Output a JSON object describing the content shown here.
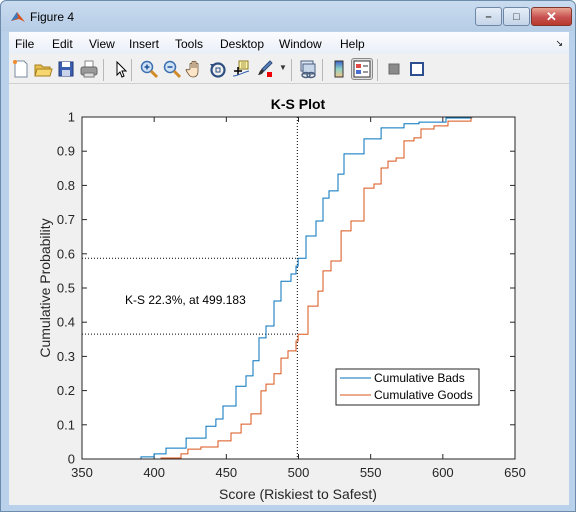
{
  "window": {
    "title": "Figure 4",
    "minimize_label": "–",
    "maximize_label": "□",
    "close_label": "✕"
  },
  "menu": {
    "items": [
      "File",
      "Edit",
      "View",
      "Insert",
      "Tools",
      "Desktop",
      "Window",
      "Help"
    ],
    "dock_arrow": "↘"
  },
  "toolbar": {
    "buttons": [
      {
        "icon": "new-figure-icon"
      },
      {
        "icon": "open-file-icon"
      },
      {
        "icon": "save-icon"
      },
      {
        "icon": "print-icon"
      },
      {
        "icon": "edit-plot-arrow-icon"
      },
      {
        "icon": "zoom-in-icon"
      },
      {
        "icon": "zoom-out-icon"
      },
      {
        "icon": "pan-hand-icon"
      },
      {
        "icon": "rotate-3d-icon"
      },
      {
        "icon": "data-cursor-icon"
      },
      {
        "icon": "brush-icon"
      },
      {
        "icon": "link-plot-icon"
      },
      {
        "icon": "colorbar-icon"
      },
      {
        "icon": "legend-icon",
        "pressed": true
      },
      {
        "icon": "hide-plot-tools-icon"
      },
      {
        "icon": "show-plot-tools-icon"
      }
    ]
  },
  "chart_data": {
    "type": "line",
    "title": "K-S Plot",
    "xlabel": "Score (Riskiest to Safest)",
    "ylabel": "Cumulative Probability",
    "xlim": [
      350,
      650
    ],
    "ylim": [
      0,
      1
    ],
    "xticks": [
      350,
      400,
      450,
      500,
      550,
      600,
      650
    ],
    "yticks": [
      0,
      0.1,
      0.2,
      0.3,
      0.4,
      0.5,
      0.6,
      0.7,
      0.8,
      0.9,
      1
    ],
    "xtick_labels": [
      "350",
      "400",
      "450",
      "500",
      "550",
      "600",
      "650"
    ],
    "ytick_labels": [
      "0",
      "0.1",
      "0.2",
      "0.3",
      "0.4",
      "0.5",
      "0.6",
      "0.7",
      "0.8",
      "0.9",
      "1"
    ],
    "grid": false,
    "legend": {
      "placement": "bottom-right",
      "entries": [
        "Cumulative Bads",
        "Cumulative Goods"
      ]
    },
    "series": [
      {
        "name": "Cumulative Bads",
        "color": "#0072bd",
        "x": [
          366.6,
          390.9,
          399.9,
          408.2,
          422.1,
          435.9,
          442.8,
          447.7,
          456.7,
          463.6,
          468.5,
          472.6,
          477.5,
          483.0,
          487.9,
          494.8,
          498.3,
          499.7,
          505.2,
          512.1,
          517.0,
          521.1,
          527.4,
          531.5,
          536.4,
          545.4,
          557.2,
          573.1,
          583.5,
          602.2,
          620.0
        ],
        "y": [
          0.0,
          0.006,
          0.015,
          0.032,
          0.061,
          0.096,
          0.117,
          0.155,
          0.213,
          0.243,
          0.287,
          0.354,
          0.389,
          0.462,
          0.52,
          0.541,
          0.564,
          0.587,
          0.652,
          0.696,
          0.763,
          0.784,
          0.833,
          0.892,
          0.892,
          0.936,
          0.968,
          0.98,
          0.985,
          0.997,
          1.0
        ]
      },
      {
        "name": "Cumulative Goods",
        "color": "#d95319",
        "x": [
          368.7,
          404.7,
          418.6,
          423.4,
          432.4,
          444.2,
          453.2,
          460.2,
          467.1,
          474.0,
          477.5,
          483.0,
          487.9,
          492.7,
          498.3,
          499.7,
          506.6,
          513.5,
          517.0,
          522.5,
          529.5,
          536.4,
          545.4,
          552.3,
          557.2,
          562.0,
          567.6,
          573.1,
          580.0,
          584.9,
          593.9,
          603.6,
          619.5,
          635.0
        ],
        "y": [
          0.0,
          0.003,
          0.015,
          0.029,
          0.035,
          0.053,
          0.076,
          0.102,
          0.132,
          0.199,
          0.219,
          0.249,
          0.295,
          0.316,
          0.345,
          0.365,
          0.447,
          0.491,
          0.55,
          0.579,
          0.667,
          0.696,
          0.792,
          0.804,
          0.851,
          0.871,
          0.88,
          0.93,
          0.939,
          0.965,
          0.974,
          0.988,
          1.0,
          1.0
        ]
      }
    ],
    "ks": {
      "score": 499.183,
      "bads_value": 0.587,
      "goods_value": 0.365,
      "annotation": "K-S 22.3%, at 499.183"
    }
  }
}
